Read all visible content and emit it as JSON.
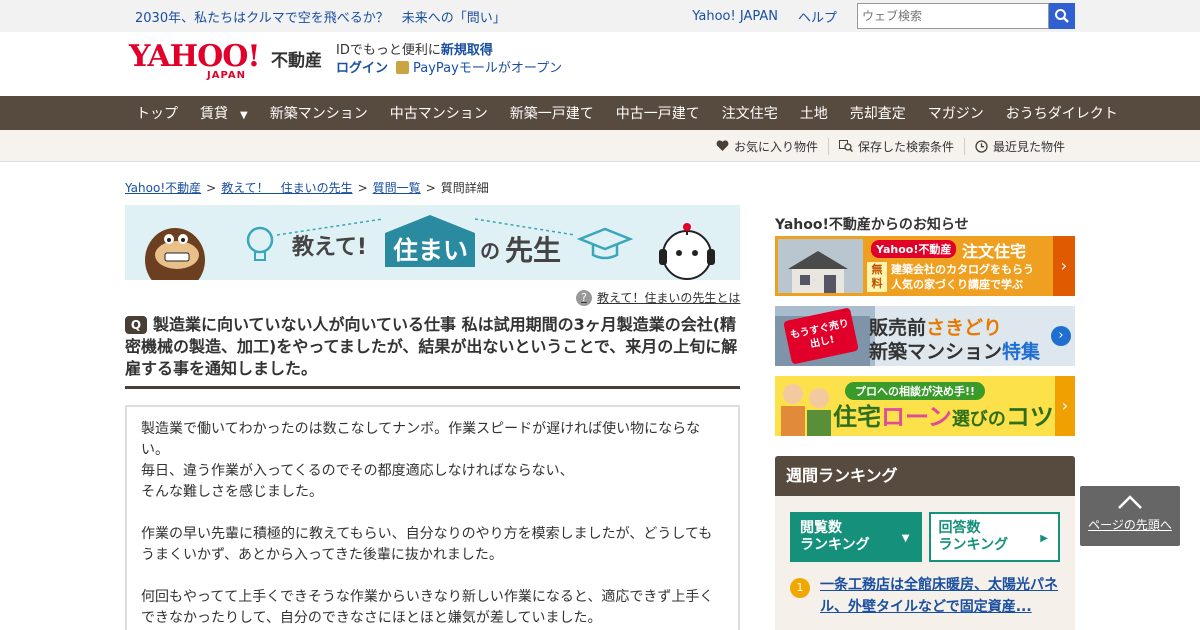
{
  "topbar": {
    "promo": "2030年、私たちはクルマで空を飛べるか？　未来への「問い」",
    "yahoo_japan": "Yahoo! JAPAN",
    "help": "ヘルプ",
    "search_placeholder": "ウェブ検索"
  },
  "header": {
    "logo": "YAHOO!",
    "logo_sub": "JAPAN",
    "logo_fudosan": "不動産",
    "id_text": "IDでもっと便利に",
    "id_register": "新規取得",
    "login": "ログイン",
    "paypay": "PayPayモールがオープン"
  },
  "nav": {
    "items": [
      "トップ",
      "賃貸",
      "新築マンション",
      "中古マンション",
      "新築一戸建て",
      "中古一戸建て",
      "注文住宅",
      "土地",
      "売却査定",
      "マガジン",
      "おうちダイレクト"
    ]
  },
  "subnav": {
    "favorites": "お気に入り物件",
    "saved_search": "保存した検索条件",
    "recent": "最近見た物件"
  },
  "breadcrumb": {
    "items": [
      "Yahoo!不動産",
      "教えて！　住まいの先生",
      "質問一覧",
      "質問詳細"
    ]
  },
  "banner": {
    "oshiete": "教えて!",
    "sumai": "住まい",
    "no": "の",
    "sensei": "先生"
  },
  "help_link": "教えて！住まいの先生とは",
  "question": {
    "badge": "Q",
    "title": "製造業に向いていない人が向いている仕事 私は試用期間の3ヶ月製造業の会社(精密機械の製造、加工)をやってましたが、結果が出ないということで、来月の上旬に解雇する事を通知しました。"
  },
  "answer": {
    "p1": "製造業で働いてわかったのは数こなしてナンボ。作業スピードが遅ければ使い物にならない。",
    "p2": "毎日、違う作業が入ってくるのでその都度適応しなければならない、",
    "p3": "そんな難しさを感じました。",
    "p4": "作業の早い先輩に積極的に教えてもらい、自分なりのやり方を模索しましたが、どうしてもうまくいかず、あとから入ってきた後輩に抜かれました。",
    "p5": "何回もやってて上手くできそうな作業からいきなり新しい作業になると、適応できず上手くできなかったりして、自分のできなさにほとほと嫌気が差していました。"
  },
  "sidebar": {
    "news_heading": "Yahoo!不動産からのお知らせ",
    "ad1": {
      "tag": "Yahoo!不動産",
      "title": "注文住宅",
      "free1": "無",
      "free2": "料",
      "line1": "建築会社のカタログをもらう",
      "line2": "人気の家づくり講座で学ぶ"
    },
    "ad2": {
      "badge": "もうすぐ売り出し!",
      "line1a": "販売前",
      "line1b": "さきどり",
      "line2a": "新築マンション",
      "line2b": "特集"
    },
    "ad3": {
      "bubble": "プロへの相談が決め手!!",
      "t1": "住宅",
      "t2": "ローン",
      "t3": "選び",
      "t4": "の",
      "t5": "コツ"
    },
    "ranking": {
      "heading": "週間ランキング",
      "tab1_line1": "閲覧数",
      "tab1_line2": "ランキング",
      "tab2_line1": "回答数",
      "tab2_line2": "ランキング",
      "item1_num": "1",
      "item1_text": "一条工務店は全館床暖房、太陽光パネル、外壁タイルなどで固定資産..."
    }
  },
  "pagetop": "ページの先頭へ",
  "colors": {
    "nav_bg": "#574a3e",
    "link": "#1a4fa0",
    "yahoo_red": "#e1002a",
    "ranking_green": "#15917b"
  }
}
